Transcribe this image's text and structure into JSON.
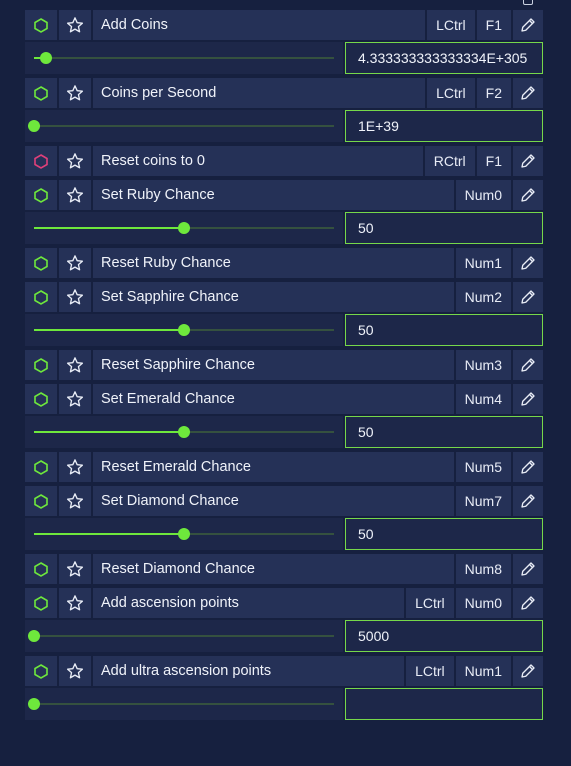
{
  "colors": {
    "accent": "#6ee83c",
    "toggle_on": "#6ee83c",
    "toggle_off": "#e0407a",
    "panel": "#253157",
    "background": "#16203f"
  },
  "icons": {
    "toggle": "hexagon-icon",
    "favorite": "star-icon",
    "edit": "pencil-icon"
  },
  "entries": [
    {
      "name": "Add Coins",
      "keys": [
        "LCtrl",
        "F1"
      ],
      "active": true,
      "slider": 0.04,
      "value": "4.333333333333334E+305"
    },
    {
      "name": "Coins per Second",
      "keys": [
        "LCtrl",
        "F2"
      ],
      "active": true,
      "slider": 0.0,
      "value": "1E+39"
    },
    {
      "name": "Reset coins to 0",
      "keys": [
        "RCtrl",
        "F1"
      ],
      "active": false
    },
    {
      "name": "Set Ruby Chance",
      "keys": [
        "Num0"
      ],
      "active": true,
      "slider": 0.5,
      "value": "50"
    },
    {
      "name": "Reset Ruby Chance",
      "keys": [
        "Num1"
      ],
      "active": true
    },
    {
      "name": "Set Sapphire Chance",
      "keys": [
        "Num2"
      ],
      "active": true,
      "slider": 0.5,
      "value": "50"
    },
    {
      "name": "Reset Sapphire Chance",
      "keys": [
        "Num3"
      ],
      "active": true
    },
    {
      "name": "Set Emerald Chance",
      "keys": [
        "Num4"
      ],
      "active": true,
      "slider": 0.5,
      "value": "50"
    },
    {
      "name": "Reset Emerald Chance",
      "keys": [
        "Num5"
      ],
      "active": true
    },
    {
      "name": "Set Diamond Chance",
      "keys": [
        "Num7"
      ],
      "active": true,
      "slider": 0.5,
      "value": "50"
    },
    {
      "name": "Reset Diamond Chance",
      "keys": [
        "Num8"
      ],
      "active": true
    },
    {
      "name": "Add ascension points",
      "keys": [
        "LCtrl",
        "Num0"
      ],
      "active": true,
      "slider": 0.0,
      "value": "5000"
    },
    {
      "name": "Add ultra ascension points",
      "keys": [
        "LCtrl",
        "Num1"
      ],
      "active": true,
      "slider": 0.0,
      "value": ""
    }
  ]
}
